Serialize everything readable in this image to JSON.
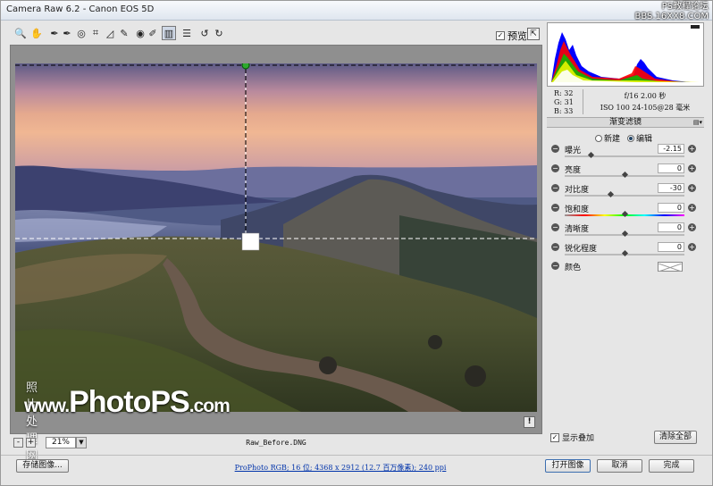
{
  "window": {
    "title": "Camera Raw 6.2 -  Canon EOS 5D",
    "watermark_top": [
      "PS教程论坛",
      "BBS.16XX8.COM"
    ]
  },
  "toolbar": {
    "tools": [
      {
        "name": "zoom-tool-icon",
        "glyph": "🔍"
      },
      {
        "name": "hand-tool-icon",
        "glyph": "✋"
      },
      {
        "name": "white-balance-tool-icon",
        "glyph": "✒"
      },
      {
        "name": "color-sampler-tool-icon",
        "glyph": "✒"
      },
      {
        "name": "targeted-adjustment-tool-icon",
        "glyph": "◎"
      },
      {
        "name": "crop-tool-icon",
        "glyph": "⌗"
      },
      {
        "name": "straighten-tool-icon",
        "glyph": "◿"
      },
      {
        "name": "spot-removal-tool-icon",
        "glyph": "✎"
      },
      {
        "name": "red-eye-tool-icon",
        "glyph": "◉"
      },
      {
        "name": "adjustment-brush-icon",
        "glyph": "✐"
      },
      {
        "name": "graduated-filter-icon",
        "glyph": "▥"
      },
      {
        "name": "preferences-icon",
        "glyph": "☰"
      },
      {
        "name": "rotate-left-icon",
        "glyph": "↺"
      },
      {
        "name": "rotate-right-icon",
        "glyph": "↻"
      }
    ],
    "preview_label": "预览",
    "preview_checked": "✓",
    "fullscreen_glyph": "⇱"
  },
  "image": {
    "filename": "Raw_Before.DNG",
    "watermark_cn": "照片处理网",
    "watermark_www": "www.",
    "watermark_brand": "PhotoPS",
    "watermark_tld": ".com",
    "info_glyph": "!"
  },
  "zoom": {
    "minus": "-",
    "plus": "+",
    "value": "21%",
    "dropdown": "▼"
  },
  "readout": {
    "r_label": "R:",
    "r": "32",
    "g_label": "G:",
    "g": "31",
    "b_label": "B:",
    "b": "33",
    "exposure": "f/16  2.00 秒",
    "iso_lens": "ISO 100  24-105@28 毫米"
  },
  "panel": {
    "title": "渐变滤镜",
    "menu_glyph": "▤▾",
    "mode_new": "新建",
    "mode_edit": "编辑",
    "mode_selected": "edit",
    "rows": [
      {
        "id": "exposure",
        "label": "曝光",
        "value": "-2.15",
        "pos": 0.22
      },
      {
        "id": "brightness",
        "label": "亮度",
        "value": "0",
        "pos": 0.5
      },
      {
        "id": "contrast",
        "label": "对比度",
        "value": "-30",
        "pos": 0.38
      },
      {
        "id": "saturation",
        "label": "饱和度",
        "value": "0",
        "pos": 0.5,
        "sat": true
      },
      {
        "id": "clarity",
        "label": "清晰度",
        "value": "0",
        "pos": 0.5
      },
      {
        "id": "sharpness",
        "label": "锐化程度",
        "value": "0",
        "pos": 0.5
      }
    ],
    "color_label": "颜色",
    "minus": "−",
    "plus": "+"
  },
  "options": {
    "show_overlay": "显示叠加",
    "show_overlay_checked": "✓",
    "clear_all": "清除全部"
  },
  "footer": {
    "save": "存储图像...",
    "workflow": "ProPhoto RGB; 16 位; 4368 x 2912 (12.7 百万像素); 240 ppi",
    "open": "打开图像",
    "cancel": "取消",
    "done": "完成"
  }
}
